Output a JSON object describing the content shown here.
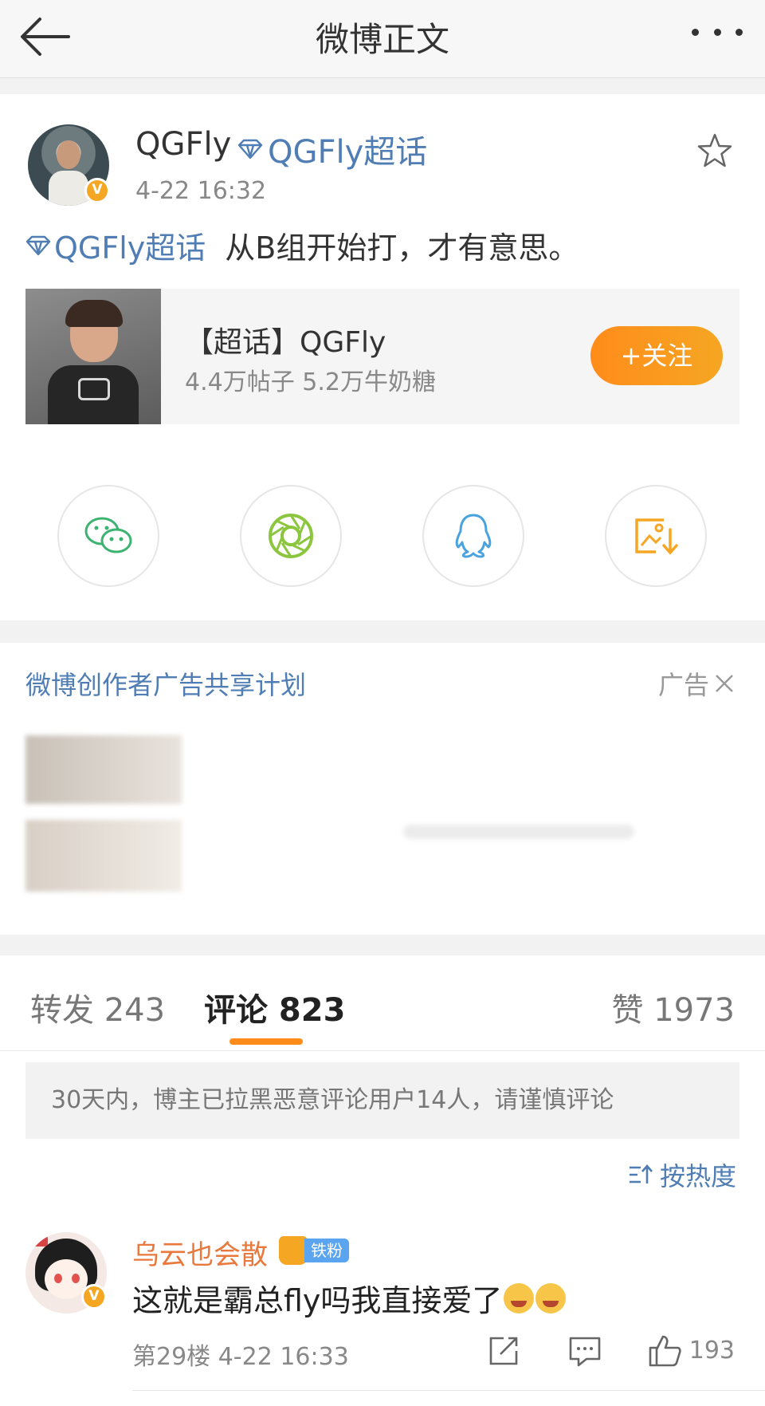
{
  "header": {
    "title": "微博正文"
  },
  "post": {
    "author": "QGFly",
    "supertopic_link": "QGFly超话",
    "timestamp": "4-22 16:32",
    "text_topic": "QGFly超话",
    "text": "从B组开始打，才有意思。",
    "verified": "V",
    "topic_card": {
      "title": "【超话】QGFly",
      "subtitle": "4.4万帖子 5.2万牛奶糖",
      "follow_label": "+关注"
    }
  },
  "share": {
    "icons": [
      "wechat-icon",
      "moments-icon",
      "qq-icon",
      "save-image-icon"
    ],
    "colors": {
      "wechat": "#3cb371",
      "moments": "#8cc63f",
      "qq": "#4aa3df",
      "save": "#f5a623"
    }
  },
  "ad": {
    "title": "微博创作者广告共享计划",
    "label": "广告"
  },
  "tabs": {
    "repost": "转发 243",
    "comments": "评论 823",
    "likes": "赞 1973"
  },
  "comments_section": {
    "notice": "30天内，博主已拉黑恶意评论用户14人，请谨慎评论",
    "sort_label": "按热度",
    "items": [
      {
        "username": "乌云也会散",
        "badge": "铁粉",
        "text": "这就是霸总fly吗我直接爱了",
        "floor_time": "第29楼 4-22 16:33",
        "likes": "193",
        "verified": "V"
      }
    ]
  },
  "colors": {
    "accent_orange": "#ff8c1a",
    "link_blue": "#4f7db4"
  }
}
